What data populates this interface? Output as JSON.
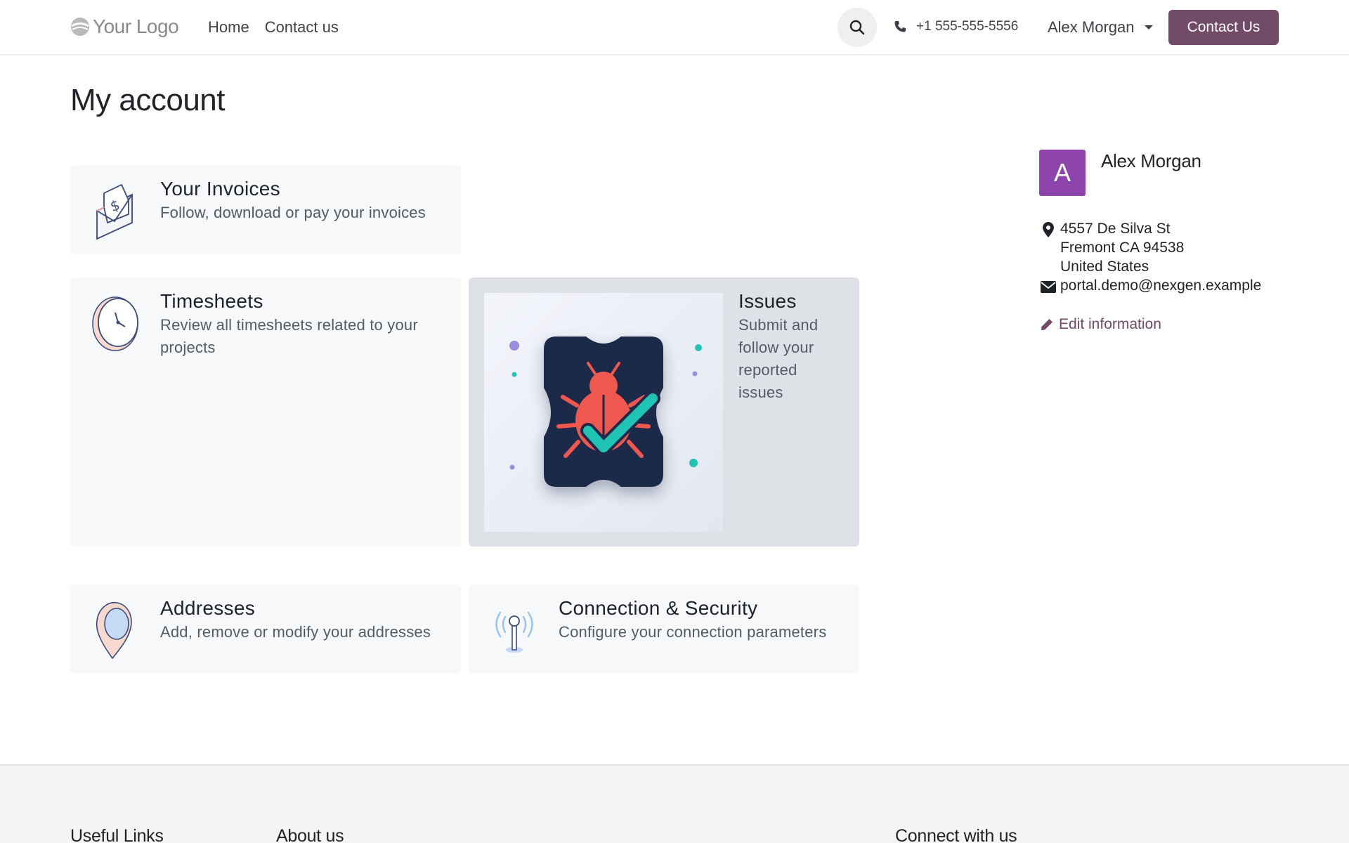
{
  "header": {
    "logo_text": "Your Logo",
    "nav": [
      "Home",
      "Contact us"
    ],
    "phone": "+1 555-555-5556",
    "user": "Alex Morgan",
    "cta": "Contact Us"
  },
  "page": {
    "title": "My account"
  },
  "cards": [
    {
      "title": "Your Invoices",
      "desc": "Follow, download or pay your invoices",
      "icon": "invoice-icon"
    },
    {
      "title": "Timesheets",
      "desc": "Review all timesheets related to your projects",
      "icon": "clock-icon"
    },
    {
      "title": "Issues",
      "desc": "Submit and follow your reported issues",
      "icon": "bug-check-icon"
    },
    {
      "title": "Addresses",
      "desc": "Add, remove or modify your addresses",
      "icon": "map-pin-icon"
    },
    {
      "title": "Connection & Security",
      "desc": "Configure your connection parameters",
      "icon": "antenna-icon"
    }
  ],
  "profile": {
    "initial": "A",
    "name": "Alex Morgan",
    "address_line1": "4557 De Silva St",
    "address_line2": "Fremont CA 94538",
    "address_line3": "United States",
    "email": "portal.demo@nexgen.example",
    "edit_label": "Edit information"
  },
  "footer": {
    "col1": "Useful Links",
    "col2": "About us",
    "col3": "Connect with us"
  },
  "colors": {
    "brand": "#714b67",
    "avatar": "#8e44ad",
    "card_bg": "#f6f8fa",
    "card_active": "#dee2e6"
  }
}
